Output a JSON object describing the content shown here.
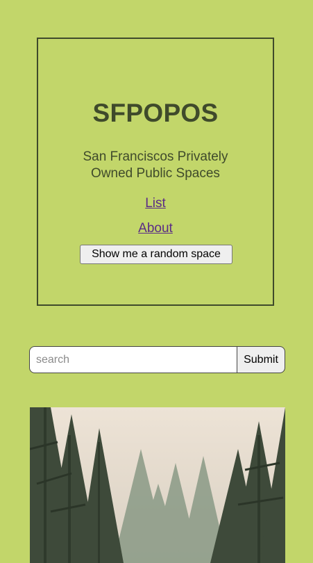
{
  "site": {
    "title": "SFPOPOS",
    "subtitle": "San Franciscos Privately Owned Public Spaces"
  },
  "nav": {
    "list_label": "List",
    "about_label": "About"
  },
  "random_button": {
    "label": "Show me a random space"
  },
  "search": {
    "placeholder": "search",
    "value": "",
    "submit_label": "Submit"
  },
  "feature_image": {
    "subject": "tree-lined plaza with tall pine trees and buildings"
  },
  "colors": {
    "background": "#c2d66a",
    "text_dark": "#3f4a2b",
    "link_visited": "#5a2b86"
  }
}
